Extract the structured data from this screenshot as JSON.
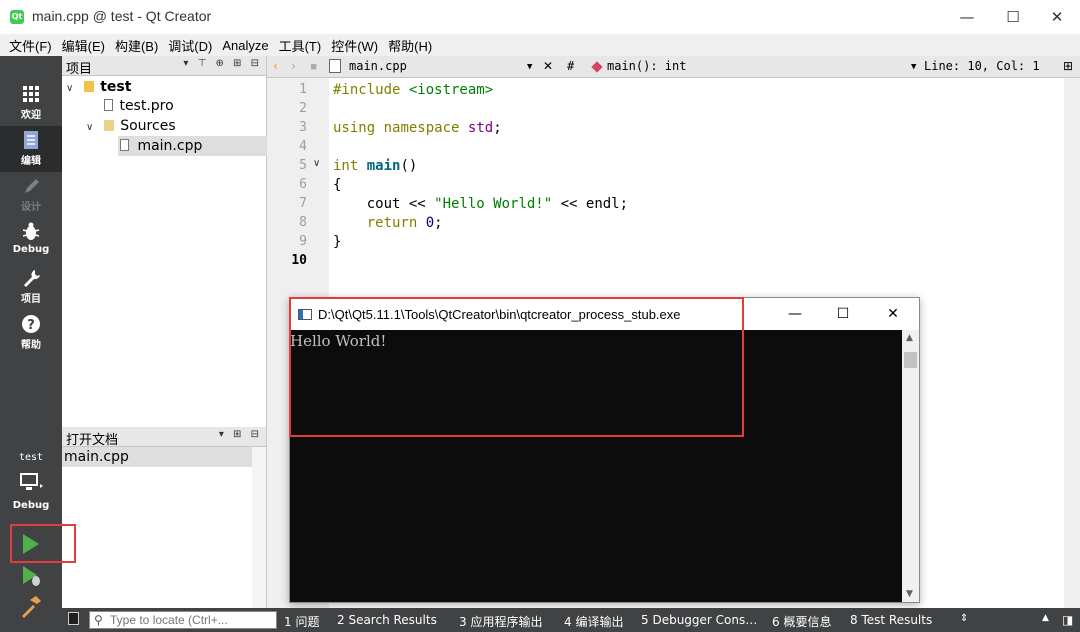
{
  "window": {
    "title": "main.cpp @ test - Qt Creator",
    "app_icon": "qt",
    "minimize": "—",
    "maximize": "☐",
    "close": "✕"
  },
  "menu": [
    "文件(F)",
    "编辑(E)",
    "构建(B)",
    "调试(D)",
    "Analyze",
    "工具(T)",
    "控件(W)",
    "帮助(H)"
  ],
  "modes": [
    {
      "label": "欢迎",
      "icon": "grid-icon"
    },
    {
      "label": "编辑",
      "icon": "edit-doc-icon"
    },
    {
      "label": "设计",
      "icon": "pencil-icon"
    },
    {
      "label": "Debug",
      "icon": "bug-icon"
    },
    {
      "label": "项目",
      "icon": "wrench-icon"
    },
    {
      "label": "帮助",
      "icon": "help-icon"
    }
  ],
  "kit": {
    "project": "test",
    "build": "Debug"
  },
  "project_pane": {
    "title": "项目",
    "tree": [
      {
        "label": "test",
        "icon": "project-folder-icon"
      },
      {
        "label": "test.pro",
        "icon": "pro-file-icon"
      },
      {
        "label": "Sources",
        "icon": "sources-folder-icon"
      },
      {
        "label": "main.cpp",
        "icon": "cpp-file-icon"
      }
    ]
  },
  "docs_pane": {
    "title": "打开文档",
    "files": [
      "main.cpp"
    ]
  },
  "editor_bar": {
    "file": "main.cpp",
    "hash": "#",
    "symbol": "main(): int",
    "position": "Line: 10, Col: 1"
  },
  "editor": {
    "line_numbers": [
      "1",
      "2",
      "3",
      "4",
      "5",
      "6",
      "7",
      "8",
      "9",
      "10"
    ],
    "current_line": "10",
    "lines": [
      {
        "parts": [
          {
            "t": "#include ",
            "c": "kw"
          },
          {
            "t": "<iostream>",
            "c": "str"
          }
        ]
      },
      {
        "parts": []
      },
      {
        "parts": [
          {
            "t": "using",
            "c": "kw"
          },
          {
            "t": " "
          },
          {
            "t": "namespace",
            "c": "kw"
          },
          {
            "t": " "
          },
          {
            "t": "std",
            "c": "ns"
          },
          {
            "t": ";"
          }
        ]
      },
      {
        "parts": []
      },
      {
        "parts": [
          {
            "t": "int",
            "c": "kw"
          },
          {
            "t": " "
          },
          {
            "t": "main",
            "c": "fn"
          },
          {
            "t": "()"
          }
        ]
      },
      {
        "parts": [
          {
            "t": "{"
          }
        ]
      },
      {
        "parts": [
          {
            "t": "    cout << "
          },
          {
            "t": "\"Hello World!\"",
            "c": "str"
          },
          {
            "t": " << endl;"
          }
        ]
      },
      {
        "parts": [
          {
            "t": "    "
          },
          {
            "t": "return",
            "c": "kw"
          },
          {
            "t": " "
          },
          {
            "t": "0",
            "c": "num"
          },
          {
            "t": ";"
          }
        ]
      },
      {
        "parts": [
          {
            "t": "}"
          }
        ]
      },
      {
        "parts": []
      }
    ]
  },
  "console": {
    "title": "D:\\Qt\\Qt5.11.1\\Tools\\QtCreator\\bin\\qtcreator_process_stub.exe",
    "output": "Hello World!",
    "minimize": "—",
    "maximize": "☐",
    "close": "✕"
  },
  "output_bar": {
    "locator_placeholder": "Type to locate (Ctrl+...",
    "tabs": [
      "1 问题",
      "2 Search Results",
      "3 应用程序输出",
      "4 编译输出",
      "5 Debugger Cons…",
      "6 概要信息",
      "8 Test Results"
    ]
  },
  "colors": {
    "highlight_box": "#e23c3c",
    "mode_bar": "#404244",
    "console_bg": "#0c0c0c"
  }
}
